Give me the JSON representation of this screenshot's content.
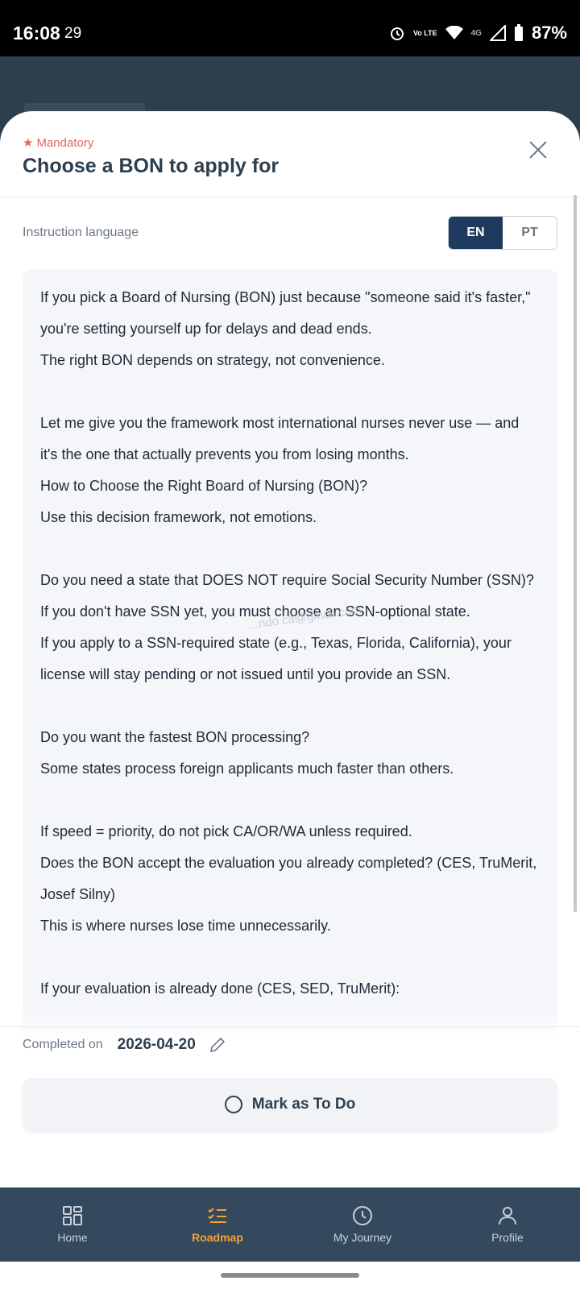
{
  "status_bar": {
    "time": "16:08",
    "extra": "29",
    "network": "4G",
    "lte": "Vo LTE",
    "battery": "87%"
  },
  "sheet": {
    "mandatory_label": "Mandatory",
    "title": "Choose a BON to apply for",
    "language": {
      "label": "Instruction language",
      "options": [
        "EN",
        "PT"
      ],
      "selected": "EN"
    },
    "paragraphs": [
      "If you pick a Board of Nursing (BON) just because \"someone said it's faster,\" you're setting yourself up for delays and dead ends.\nThe right BON depends on strategy, not convenience.",
      "Let me give you the framework most international nurses never use — and it's the one that actually prevents you from losing months.\nHow to Choose the Right Board of Nursing (BON)?\nUse this decision framework, not emotions.",
      "Do you need a state that DOES NOT require Social Security Number (SSN)?\nIf you don't have SSN yet, you must choose an SSN-optional state.\nIf you apply to a SSN-required state (e.g., Texas, Florida, California), your license will stay pending or not issued until you provide an SSN.",
      "Do you want the fastest BON processing?\nSome states process foreign applicants much faster than others.",
      "If speed = priority, do not pick CA/OR/WA unless required.\nDoes the BON accept the evaluation you already completed? (CES, TruMerit, Josef Silny)\nThis is where nurses lose time unnecessarily.",
      "If your evaluation is already done (CES, SED, TruMerit):"
    ],
    "watermark": "...ndo.ca@gmail.com",
    "completed_label": "Completed on",
    "completed_date": "2026-04-20",
    "mark_button": "Mark as To Do"
  },
  "nav": {
    "items": [
      {
        "label": "Home",
        "icon": "grid-icon"
      },
      {
        "label": "Roadmap",
        "icon": "checklist-icon"
      },
      {
        "label": "My Journey",
        "icon": "clock-icon"
      },
      {
        "label": "Profile",
        "icon": "person-icon"
      }
    ],
    "active": "Roadmap"
  },
  "colors": {
    "accent": "#f0a33b",
    "primary": "#1f3a5f",
    "mandatory": "#e06666",
    "nav_bg": "#34495e"
  }
}
